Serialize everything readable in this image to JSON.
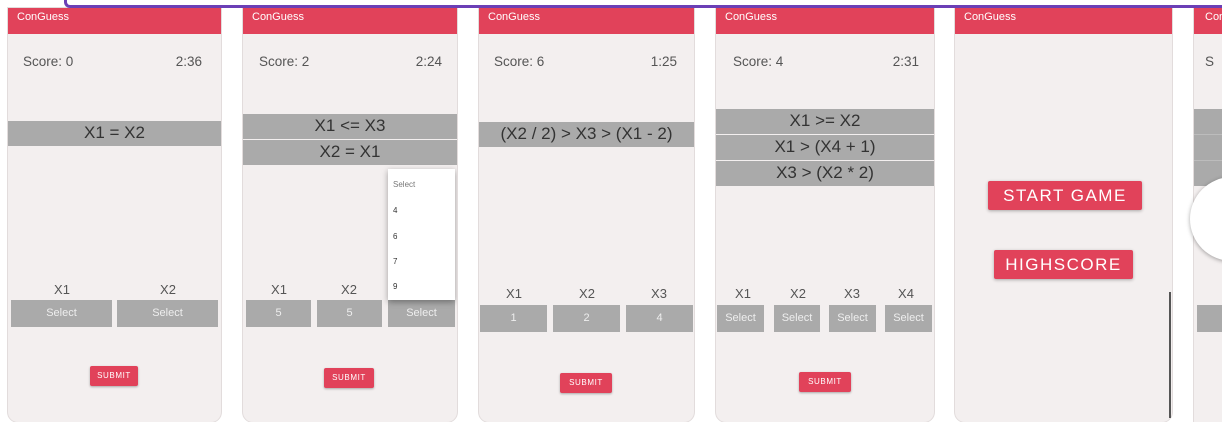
{
  "app_title": "ConGuess",
  "submit_label": "SUBMIT",
  "colors": {
    "appbar": "#e1425a",
    "constraint_bg": "#aaaaaa",
    "screen_bg": "#f3efef",
    "frame": "#6b3fb6"
  },
  "screens": [
    {
      "score": "Score: 0",
      "timer": "2:36",
      "constraints": [
        "X1 = X2"
      ],
      "vars": [
        "X1",
        "X2"
      ],
      "values": [
        "Select",
        "Select"
      ]
    },
    {
      "score": "Score: 2",
      "timer": "2:24",
      "constraints": [
        "X1 <= X3",
        "X2 = X1"
      ],
      "vars": [
        "X1",
        "X2",
        "X3"
      ],
      "values": [
        "5",
        "5",
        "Select"
      ],
      "dropdown": [
        "Select",
        "4",
        "6",
        "7",
        "9"
      ]
    },
    {
      "score": "Score: 6",
      "timer": "1:25",
      "constraints": [
        "(X2 / 2) > X3 > (X1 - 2)"
      ],
      "vars": [
        "X1",
        "X2",
        "X3"
      ],
      "values": [
        "1",
        "2",
        "4"
      ]
    },
    {
      "score": "Score: 4",
      "timer": "2:31",
      "constraints": [
        "X1 >= X2",
        "X1 > (X4 + 1)",
        "X3 > (X2 * 2)"
      ],
      "vars": [
        "X1",
        "X2",
        "X3",
        "X4"
      ],
      "values": [
        "Select",
        "Select",
        "Select",
        "Select"
      ]
    }
  ],
  "menu": {
    "start": "START GAME",
    "highscore": "HIGHSCORE"
  },
  "partial": {
    "title": "Con",
    "score_fragment": "S"
  }
}
